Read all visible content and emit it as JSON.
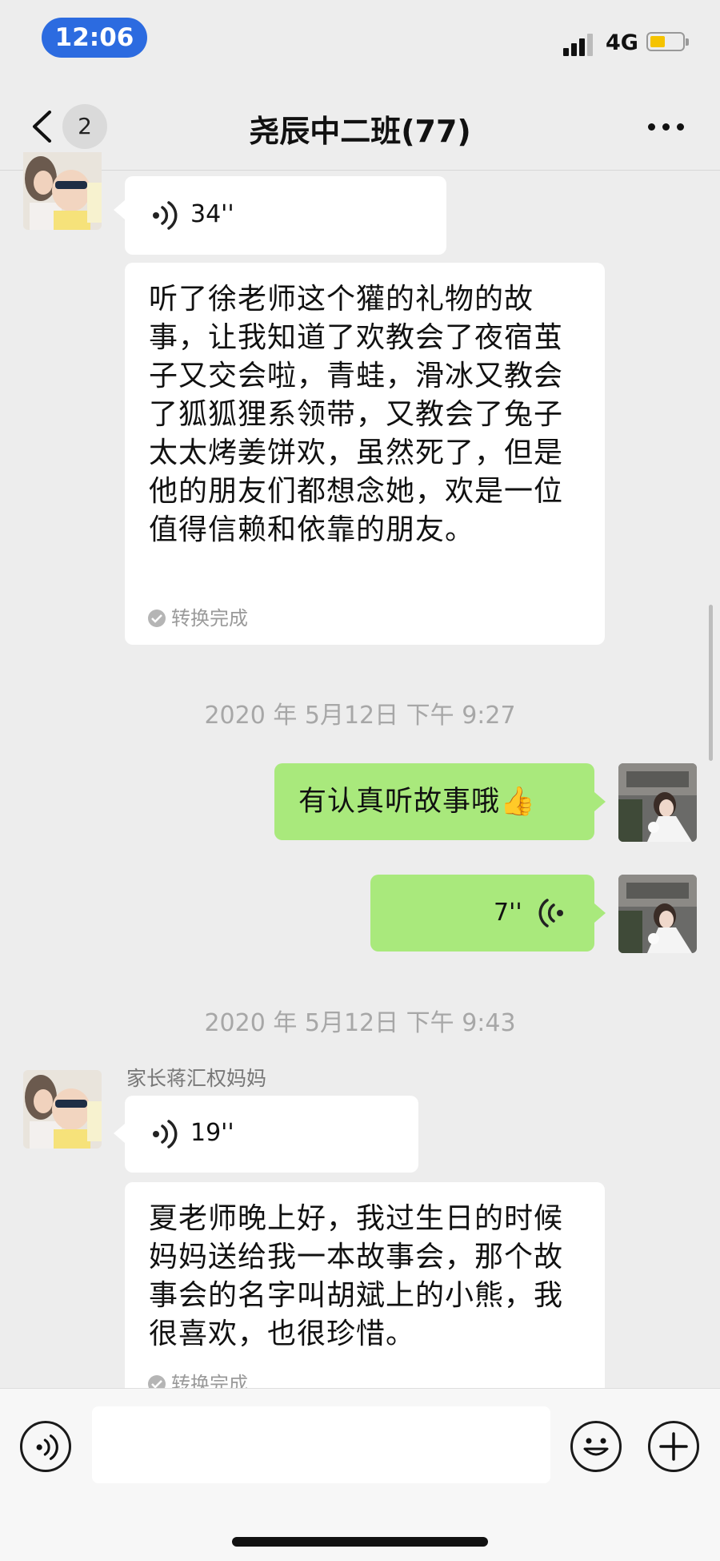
{
  "status_bar": {
    "time": "12:06",
    "network": "4G"
  },
  "nav": {
    "unread_count": "2",
    "title": "尧辰中二班(77)"
  },
  "messages": {
    "m1_voice": "34''",
    "m1_text": "听了徐老师这个獾的礼物的故事，让我知道了欢教会了夜宿茧子又交会啦，青蛙，滑冰又教会了狐狐狸系领带，又教会了兔子太太烤姜饼欢，虽然死了，但是他的朋友们都想念她，欢是一位值得信赖和依靠的朋友。",
    "m1_convert": "转换完成",
    "ts1": "2020 年 5月12日 下午 9:27",
    "m2_text": "有认真听故事哦👍",
    "m3_voice": "7''",
    "ts2": "2020 年 5月12日 下午 9:43",
    "m4_sender": "家长蒋汇权妈妈",
    "m4_voice": "19''",
    "m4_text": "夏老师晚上好，我过生日的时候妈妈送给我一本故事会，那个故事会的名字叫胡斌上的小熊，我很喜欢，也很珍惜。",
    "m4_convert": "转换完成"
  },
  "colors": {
    "self_bubble": "#a9e97c",
    "other_bubble": "#ffffff",
    "time_pill": "#2c6be0",
    "background": "#ededed"
  },
  "icons": [
    "back-icon",
    "more-icon",
    "voice-wave-icon",
    "check-circle-icon",
    "voice-input-icon",
    "emoji-icon",
    "plus-icon"
  ]
}
